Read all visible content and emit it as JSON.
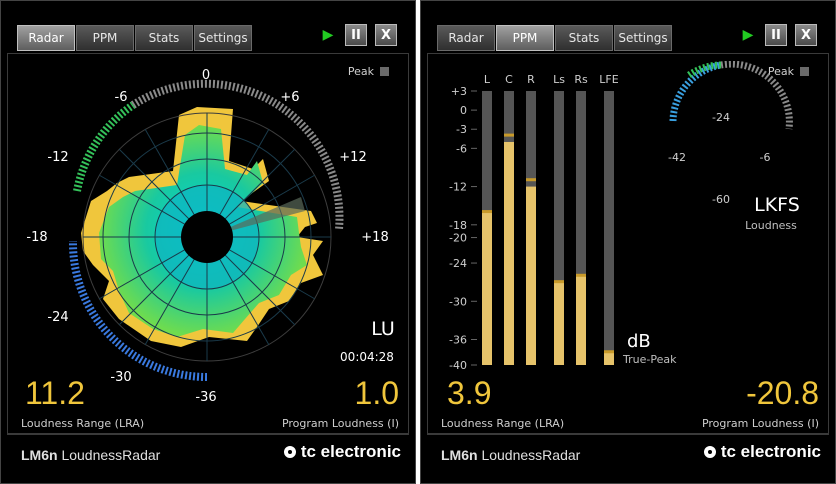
{
  "tabs": [
    "Radar",
    "PPM",
    "Stats",
    "Settings"
  ],
  "controls": {
    "pause": "II",
    "close": "X"
  },
  "peak_label": "Peak",
  "radar": {
    "ticks": [
      "0",
      "+6",
      "+12",
      "+18",
      "-36",
      "-30",
      "-24",
      "-18",
      "-12",
      "-6"
    ],
    "unit": "LU",
    "time": "00:04:28",
    "lra_value": "11.2",
    "lra_label": "Loudness Range (LRA)",
    "program_value": "1.0",
    "program_label": "Program Loudness (I)"
  },
  "ppm": {
    "channels": [
      "L",
      "C",
      "R",
      "Ls",
      "Rs",
      "LFE"
    ],
    "scale": [
      "+3",
      "0",
      "-3",
      "-6",
      "-12",
      "-18",
      "-20",
      "-24",
      "-30",
      "-36",
      "-40"
    ],
    "peak_unit": "dB",
    "peak_sub": "True-Peak",
    "lufs_ticks": [
      "-24",
      "-42",
      "-6",
      "-60"
    ],
    "lufs_unit": "LKFS",
    "lufs_sub": "Loudness",
    "lra_value": "3.9",
    "lra_label": "Loudness Range (LRA)",
    "program_value": "-20.8",
    "program_label": "Program Loudness (I)",
    "levels_db": [
      -16,
      -5,
      -12,
      -27,
      -26,
      -38
    ],
    "peak_hold_db": [
      -16,
      -4,
      -11,
      -27,
      -26,
      -38
    ]
  },
  "brand": {
    "model": "LM6n",
    "name": "LoudnessRadar",
    "maker": "tc electronic"
  }
}
